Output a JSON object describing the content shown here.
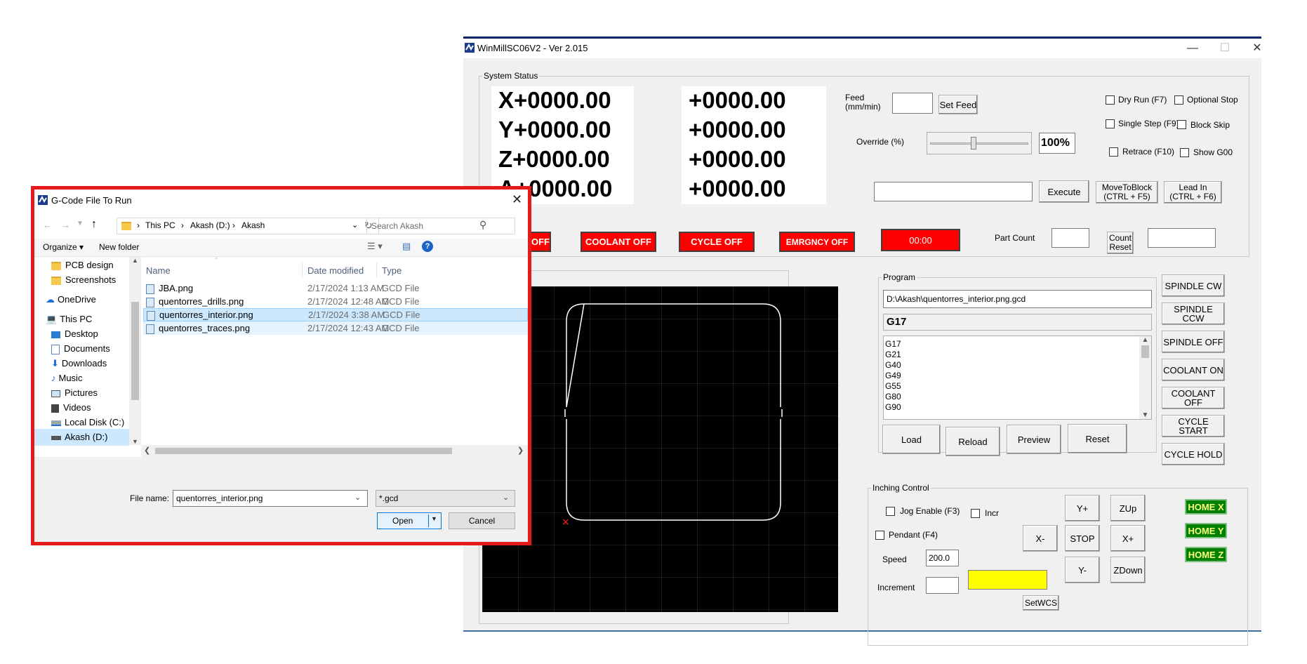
{
  "winmill": {
    "title": "WinMillSC06V2 - Ver 2.015",
    "system_status_label": "System Status",
    "coords_machine": [
      "X+0000.00",
      "Y+0000.00",
      "Z+0000.00",
      "A+0000.00"
    ],
    "coords_work": [
      "+0000.00",
      "+0000.00",
      "+0000.00",
      "+0000.00"
    ],
    "feed_label": "Feed\n(mm/min)",
    "set_feed": "Set Feed",
    "override_label": "Override (%)",
    "override_value": "100%",
    "execute": "Execute",
    "move_to_block": "MoveToBlock\n(CTRL + F5)",
    "lead_in": "Lead In\n(CTRL + F6)",
    "checkboxes": {
      "dry_run": "Dry Run (F7)",
      "optional_stop": "Optional Stop",
      "single_step": "Single Step (F9)",
      "block_skip": "Block Skip",
      "retrace": "Retrace (F10)",
      "show_g00": "Show G00"
    },
    "status": {
      "spindle": "OFF",
      "coolant": "COOLANT OFF",
      "cycle": "CYCLE OFF",
      "emergency": "EMRGNCY OFF",
      "timer": "00:00"
    },
    "part_count_label": "Part Count",
    "count_reset": "Count\nReset",
    "program": {
      "label": "Program",
      "path": "D:\\Akash\\quentorres_interior.png.gcd",
      "current": "G17",
      "lines": [
        "G17",
        "G21",
        "G40",
        "G49",
        "G55",
        "G80",
        "G90"
      ],
      "load": "Load",
      "reload": "Reload",
      "preview": "Preview",
      "reset": "Reset"
    },
    "spindle_buttons": [
      "SPINDLE CW",
      "SPINDLE CCW",
      "SPINDLE OFF",
      "COOLANT ON",
      "COOLANT OFF",
      "CYCLE START",
      "CYCLE HOLD"
    ],
    "inching": {
      "label": "Inching Control",
      "jog_enable": "Jog Enable (F3)",
      "incr": "Incr",
      "pendant": "Pendant (F4)",
      "speed_label": "Speed",
      "speed_value": "200.0",
      "increment_label": "Increment",
      "setwcs": "SetWCS",
      "y_plus": "Y+",
      "z_up": "ZUp",
      "x_minus": "X-",
      "stop": "STOP",
      "x_plus": "X+",
      "y_minus": "Y-",
      "z_down": "ZDown"
    },
    "home": [
      "HOME X",
      "HOME Y",
      "HOME Z"
    ]
  },
  "dialog": {
    "title": "G-Code File To Run",
    "breadcrumb": [
      "This PC",
      "Akash (D:)",
      "Akash"
    ],
    "search_placeholder": "Search Akash",
    "organize": "Organize ▾",
    "new_folder": "New folder",
    "sidebar": [
      "PCB design",
      "Screenshots",
      "OneDrive",
      "This PC",
      "Desktop",
      "Documents",
      "Downloads",
      "Music",
      "Pictures",
      "Videos",
      "Local Disk (C:)",
      "Akash (D:)"
    ],
    "columns": [
      "Name",
      "Date modified",
      "Type"
    ],
    "files": [
      {
        "name": "JBA.png",
        "date": "2/17/2024 1:13 AM",
        "type": "GCD File"
      },
      {
        "name": "quentorres_drills.png",
        "date": "2/17/2024 12:48 AM",
        "type": "GCD File"
      },
      {
        "name": "quentorres_interior.png",
        "date": "2/17/2024 3:38 AM",
        "type": "GCD File"
      },
      {
        "name": "quentorres_traces.png",
        "date": "2/17/2024 12:43 AM",
        "type": "GCD File"
      }
    ],
    "file_name_label": "File name:",
    "file_name_value": "quentorres_interior.png",
    "filter": "*.gcd",
    "open": "Open",
    "cancel": "Cancel"
  },
  "colors": {
    "status_red": "#ff0000",
    "home_green": "#008000",
    "highlight": "#cce8ff",
    "dialog_border": "#e51a1a"
  }
}
